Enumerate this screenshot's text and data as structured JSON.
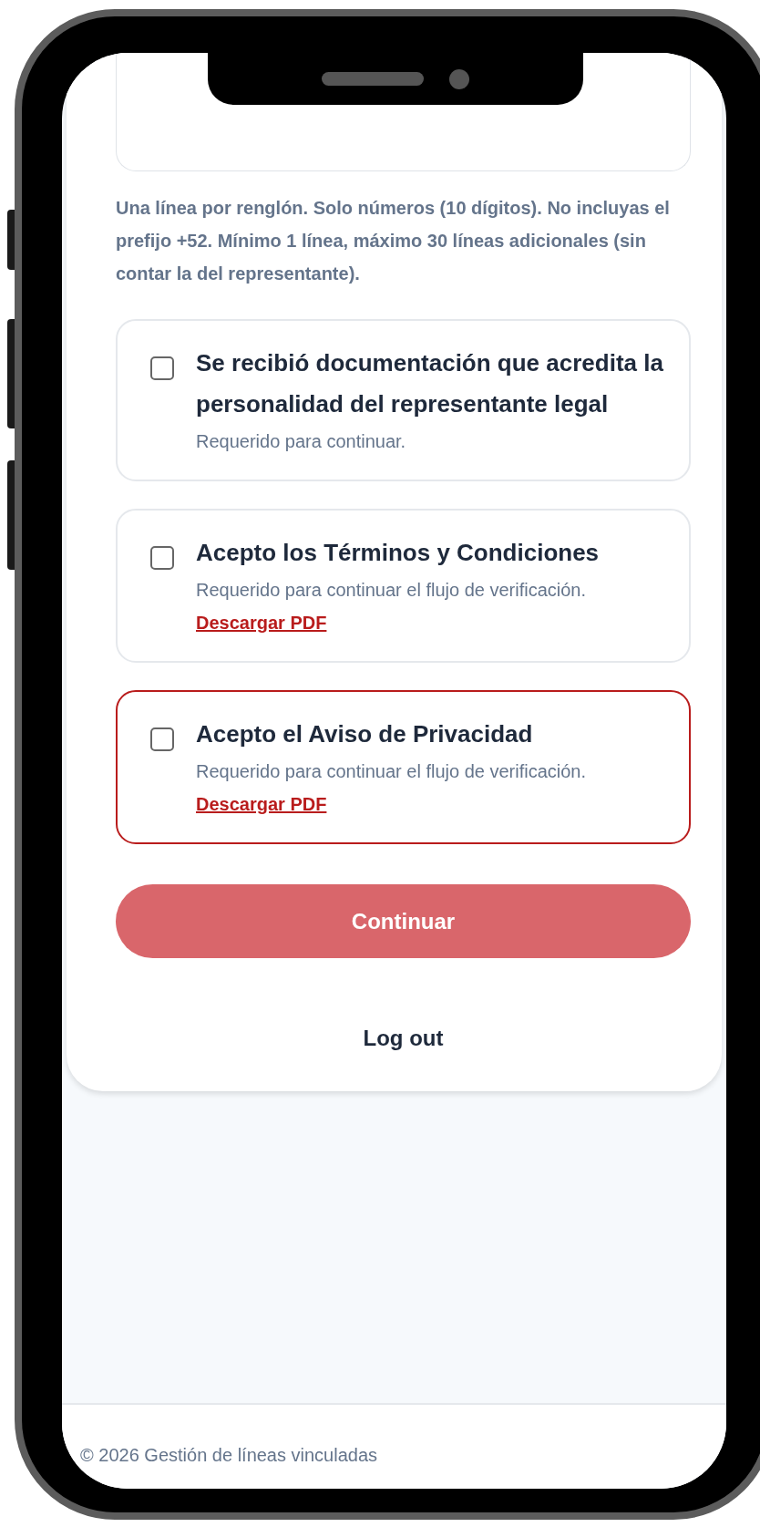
{
  "hint": "Una línea por renglón. Solo números (10 dígitos). No incluyas el prefijo +52. Mínimo 1 línea, máximo 30 líneas adicionales (sin contar la del representante).",
  "consents": [
    {
      "title": "Se recibió documentación que acredita la personalidad del representante legal",
      "note": "Requerido para continuar.",
      "checked": false,
      "invalid": false
    },
    {
      "title": "Acepto los Términos y Condiciones",
      "note": "Requerido para continuar el flujo de verificación.",
      "link": "Descargar PDF",
      "checked": false,
      "invalid": false
    },
    {
      "title": "Acepto el Aviso de Privacidad",
      "note": "Requerido para continuar el flujo de verificación.",
      "link": "Descargar PDF",
      "checked": false,
      "invalid": true
    }
  ],
  "continue_button": {
    "label": "Continuar",
    "disabled": true
  },
  "logout": "Log out",
  "footer": "© 2026 Gestión de líneas vinculadas"
}
